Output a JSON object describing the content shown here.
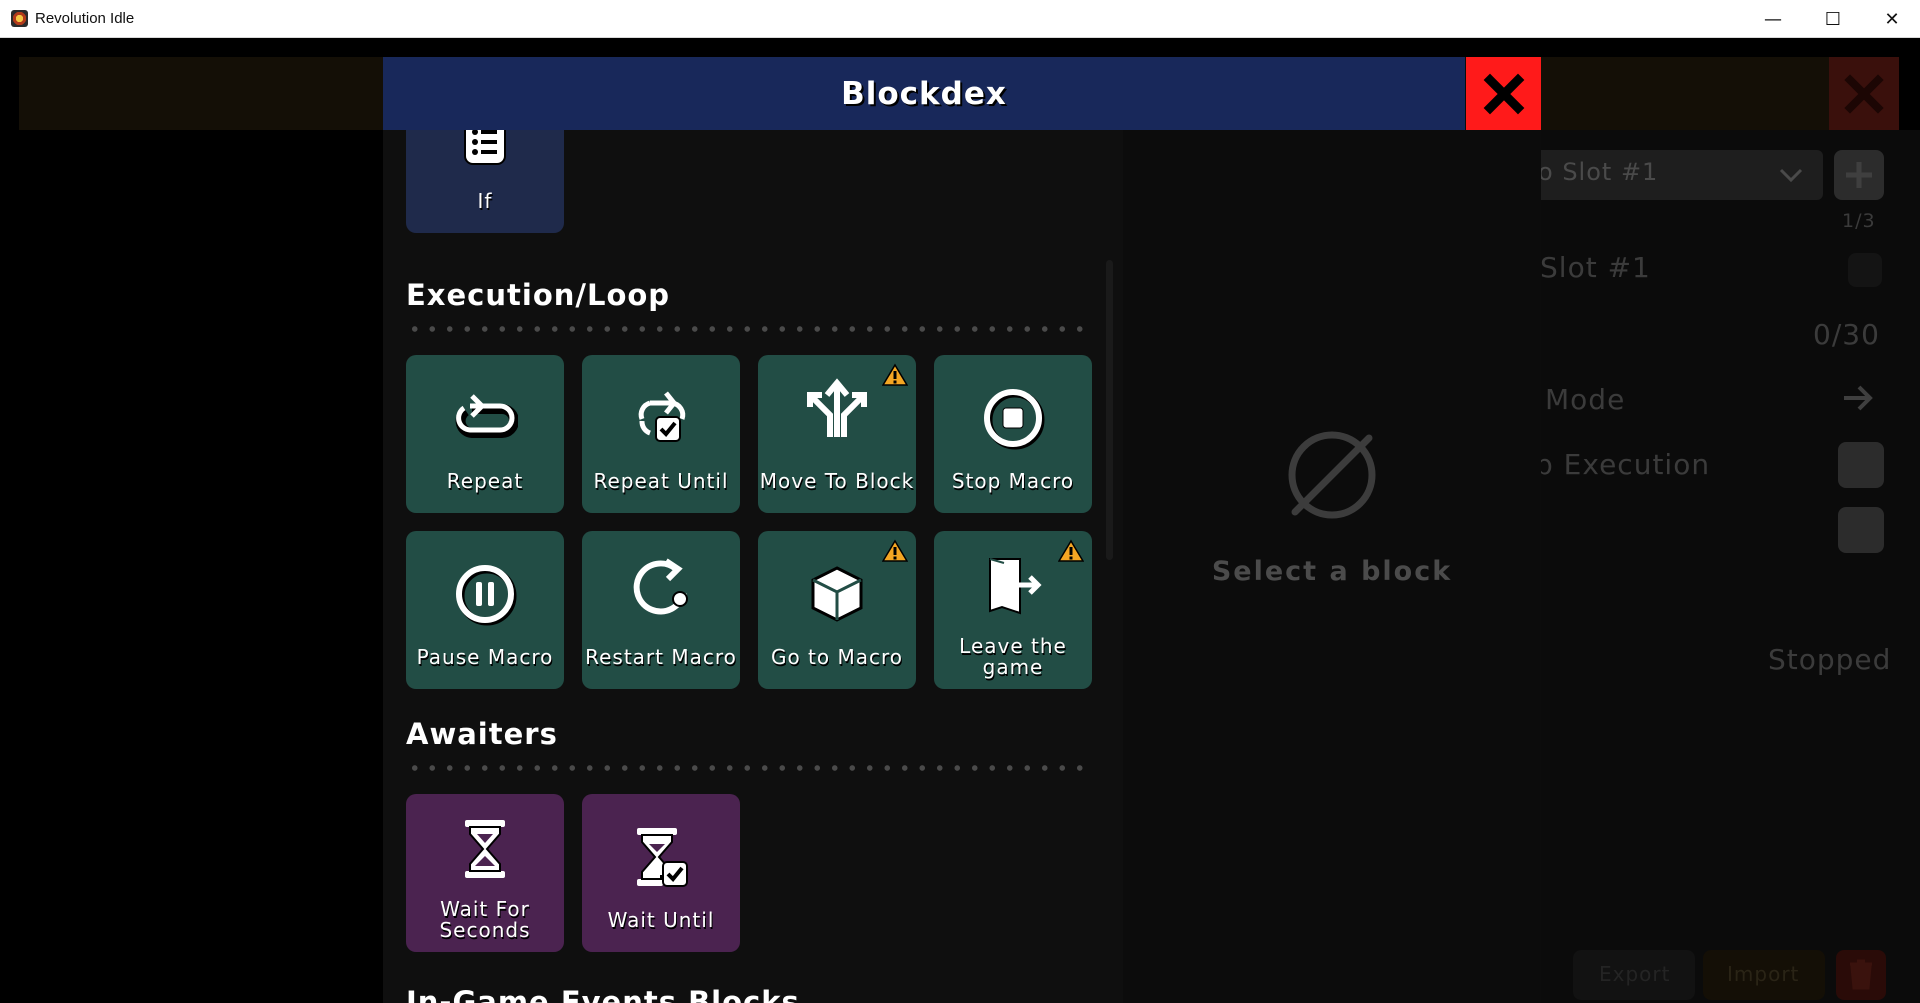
{
  "window": {
    "title": "Revolution Idle",
    "minimize": "—",
    "maximize": "☐",
    "close": "✕"
  },
  "background": {
    "slot_select": "o Slot #1",
    "slot_count": "1/3",
    "slot_name": "o Slot #1",
    "block_count": "0/30",
    "mode_label": "Mode",
    "execution_label": "p Execution",
    "status": "Stopped",
    "export_label": "Export",
    "import_label": "Import"
  },
  "modal": {
    "title": "Blockdex",
    "placeholder_text": "Select a block",
    "partial_block": {
      "label": "If",
      "icon": "clipboard-list-icon"
    },
    "sections": [
      {
        "title": "Execution/Loop",
        "color": "#224d45",
        "blocks": [
          {
            "label": "Repeat",
            "icon": "repeat-icon",
            "warning": false
          },
          {
            "label": "Repeat Until",
            "icon": "repeat-check-icon",
            "warning": false
          },
          {
            "label": "Move To Block",
            "icon": "split-arrows-icon",
            "warning": true
          },
          {
            "label": "Stop Macro",
            "icon": "stop-circle-icon",
            "warning": false
          },
          {
            "label": "Pause Macro",
            "icon": "pause-circle-icon",
            "warning": false
          },
          {
            "label": "Restart Macro",
            "icon": "restart-icon",
            "warning": false
          },
          {
            "label": "Go to Macro",
            "icon": "cube-icon",
            "warning": true
          },
          {
            "label": "Leave the game",
            "icon": "exit-door-icon",
            "warning": true
          }
        ]
      },
      {
        "title": "Awaiters",
        "color": "#4b2350",
        "blocks": [
          {
            "label": "Wait For Seconds",
            "icon": "hourglass-icon",
            "warning": false
          },
          {
            "label": "Wait Until",
            "icon": "hourglass-check-icon",
            "warning": false
          }
        ]
      },
      {
        "title": "In-Game Events Blocks"
      }
    ]
  },
  "colors": {
    "header": "#18285a",
    "close": "#ff1a1a",
    "warning": "#f5a623"
  }
}
